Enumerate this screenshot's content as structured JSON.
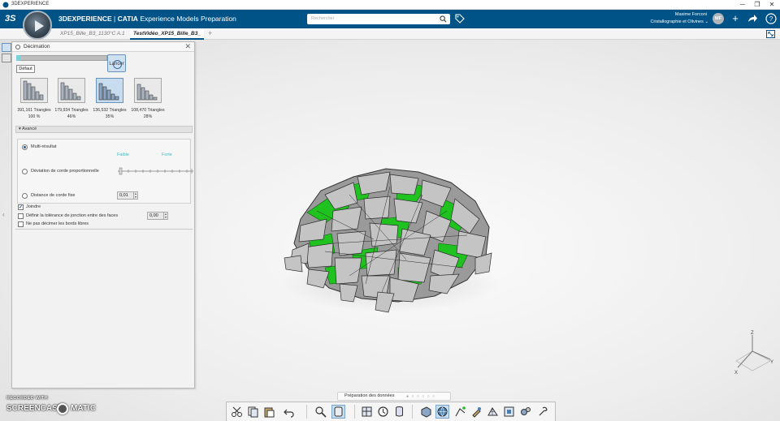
{
  "window": {
    "title": "3DEXPERIENCE",
    "minimize": "─",
    "maximize": "❐",
    "close": "✕"
  },
  "topbar": {
    "ds_logo": "3S",
    "brand_platform": "3DEXPERIENCE",
    "brand_separator": " | ",
    "brand_product": "CATIA",
    "brand_app": " Experience Models Preparation",
    "search_placeholder": "Rechercher",
    "user_name": "Maxime Forconi",
    "user_org": "Cristallographie et Olivines ⌄",
    "avatar_initials": "MF",
    "accent": "#005386"
  },
  "tabs": [
    {
      "label": "XP15_Bille_B3_1130°C A.1",
      "active": false
    },
    {
      "label": "TestVidéo_XP15_Bille_B3_",
      "active": true
    }
  ],
  "tab_add": "+",
  "panel": {
    "title": "Décimation",
    "close": "✕",
    "lancer_label": "Lancer",
    "defaut_label": "Défaut",
    "results": [
      {
        "triangles": "391,161 Triangles",
        "percent": "100 %",
        "selected": false
      },
      {
        "triangles": "179,934 Triangles",
        "percent": "46%",
        "selected": false
      },
      {
        "triangles": "136,532 Triangles",
        "percent": "35%",
        "selected": true
      },
      {
        "triangles": "108,470 Triangles",
        "percent": "28%",
        "selected": false
      }
    ],
    "advanced": {
      "header": "▾  Avancé",
      "multi_result": "Multi-résultat",
      "low": "Faible",
      "high": "Forte",
      "chord_dev": "Déviation de corde proportionnelle",
      "chord_dist": "Distance de corde fixe",
      "chord_dist_value": "0,01"
    },
    "join_label": "Joindre",
    "join_checked": true,
    "tolerance_label": "Définir la tolérance de jonction entre des faces",
    "tolerance_value": "0,00",
    "free_edges_label": "Ne pas décimer les bords libres"
  },
  "bottom": {
    "stage_label": "Préparation des données",
    "stage_dots": "● ○ ○ ○ ○ ○"
  },
  "triad": {
    "x": "X",
    "y": "Y",
    "z": "Z"
  },
  "watermark": {
    "recorded": "RECORDED WITH",
    "brand_left": "SCREENCAST",
    "brand_right": "MATIC"
  },
  "colors": {
    "mesh_gray": "#bcbcbc",
    "mesh_green": "#1fc21f",
    "selection_blue": "#c7dcef"
  }
}
